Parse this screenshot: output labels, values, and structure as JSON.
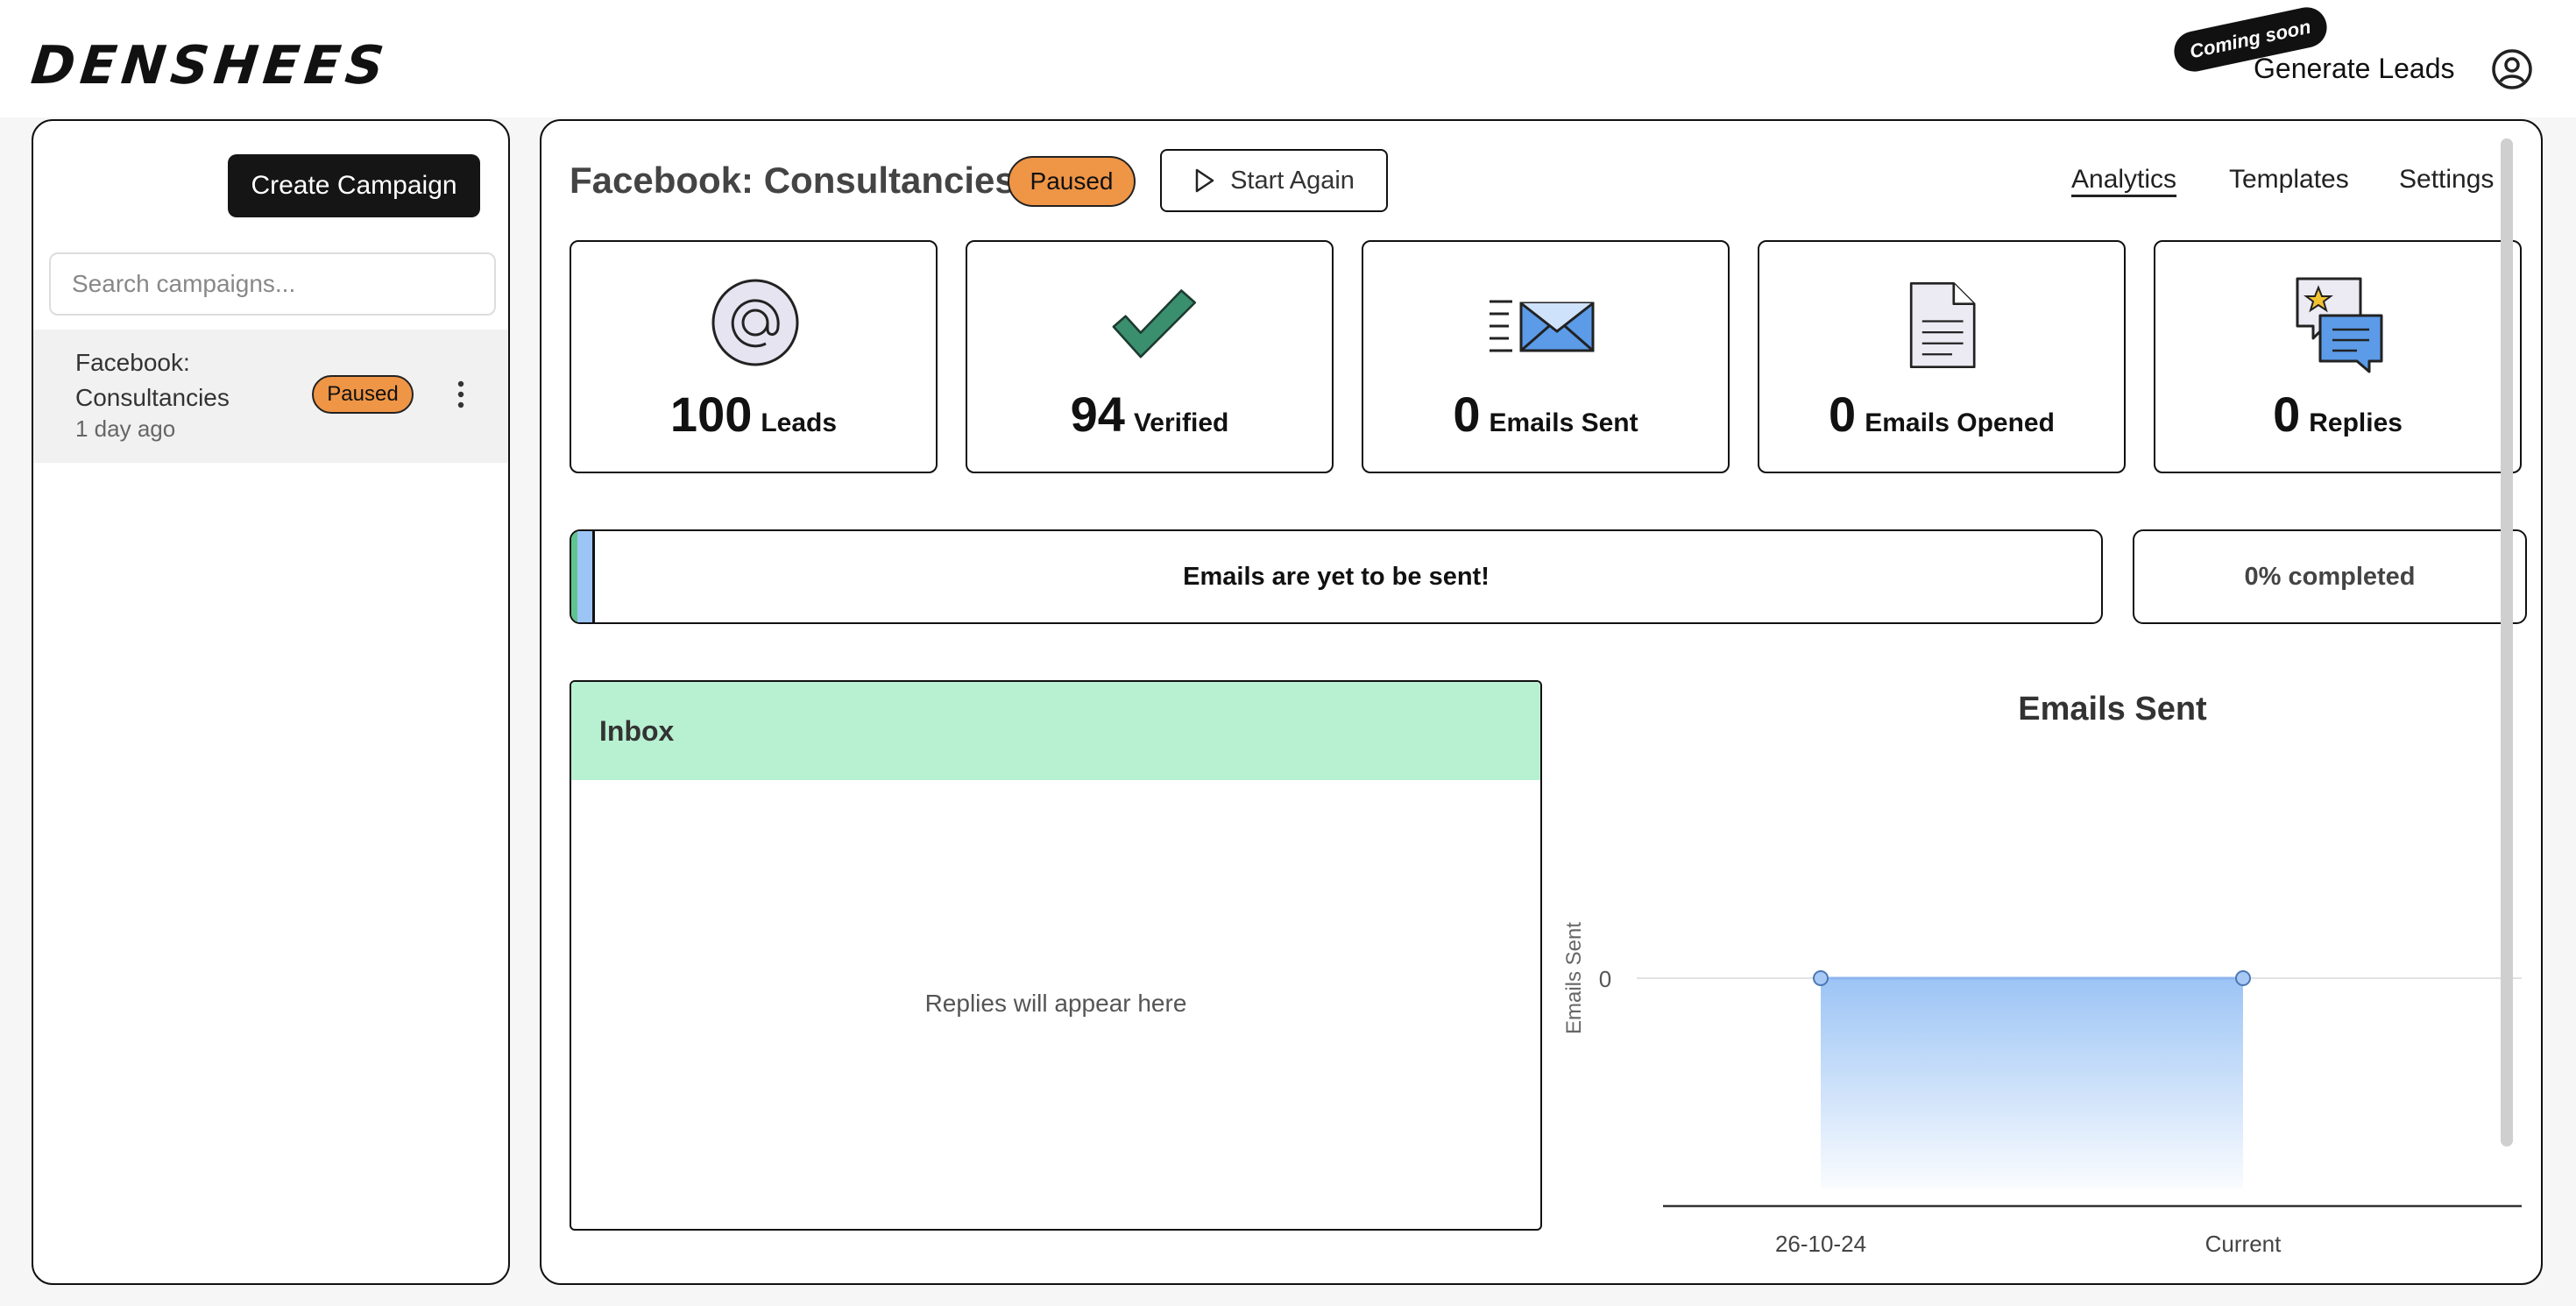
{
  "app": {
    "logo": "DENSHEES"
  },
  "topbar": {
    "coming_soon": "Coming soon",
    "generate_leads": "Generate Leads"
  },
  "sidebar": {
    "create_label": "Create Campaign",
    "search_placeholder": "Search campaigns...",
    "campaigns": [
      {
        "name": "Facebook: Consultancies",
        "status": "Paused",
        "time": "1 day ago"
      }
    ]
  },
  "campaign": {
    "title": "Facebook: Consultancies",
    "status": "Paused",
    "start_again_label": "Start Again"
  },
  "nav": {
    "tabs": [
      "Analytics",
      "Templates",
      "Settings"
    ],
    "active": "Analytics"
  },
  "stats": [
    {
      "icon": "at-sign-icon",
      "value": "100",
      "label": "Leads"
    },
    {
      "icon": "checkmark-icon",
      "value": "94",
      "label": "Verified"
    },
    {
      "icon": "envelope-icon",
      "value": "0",
      "label": "Emails Sent"
    },
    {
      "icon": "document-icon",
      "value": "0",
      "label": "Emails Opened"
    },
    {
      "icon": "chat-bubbles-icon",
      "value": "0",
      "label": "Replies"
    }
  ],
  "progress": {
    "message": "Emails are yet to be sent!",
    "completed_text": "0% completed",
    "percent": 0
  },
  "inbox": {
    "title": "Inbox",
    "empty_text": "Replies will appear here"
  },
  "colors": {
    "accent_badge": "#ef9546",
    "inbox_header": "#b8f0d2",
    "chart_fill": "#9cc4f5",
    "check": "#3a8f6f"
  },
  "chart_data": {
    "type": "area",
    "title": "Emails Sent",
    "xlabel": "",
    "ylabel": "Emails Sent",
    "categories": [
      "26-10-24",
      "Current"
    ],
    "values": [
      0,
      0
    ],
    "y_ticks": [
      "0"
    ],
    "grid": true,
    "legend": "none"
  }
}
